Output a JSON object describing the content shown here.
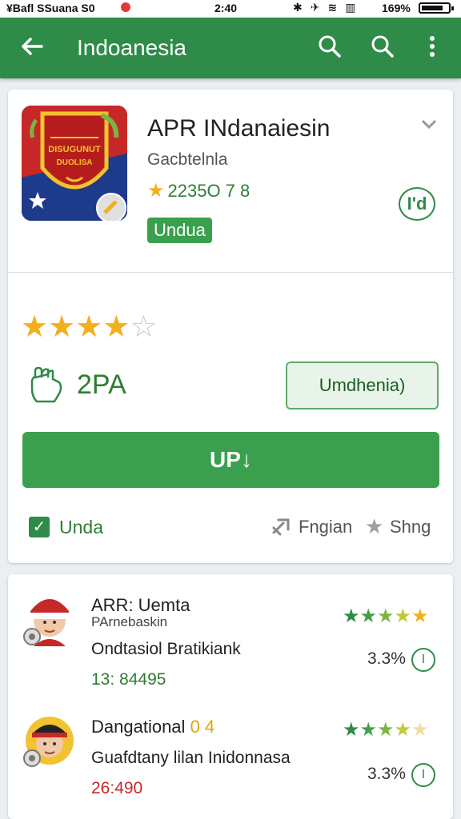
{
  "status_bar": {
    "carrier": "¥Bafl SSuana S0",
    "time": "2:40",
    "battery": "169%"
  },
  "app_bar": {
    "title": "Indoanesia"
  },
  "app": {
    "title": "APR INdanaiesin",
    "developer": "Gacbtelnla",
    "rating_text": "2235O 7 8",
    "badge": "Undua",
    "side_button": "I'd",
    "icon_text": "DISUGUNUT DUOLISA"
  },
  "rating": {
    "stars": 4,
    "max": 5
  },
  "stats": {
    "count": "2PA",
    "secondary_button": "Umdhenia)"
  },
  "primary_button": "UP↓",
  "actions": {
    "check_label": "Unda",
    "link_label": "Fngian",
    "share_label": "Shng"
  },
  "reviews": [
    {
      "name": "ARR: Uemta",
      "sub": "PArnebaskin",
      "text": "Ondtasiol Bratikiank",
      "date": "13: 84495",
      "percent": "3.3%",
      "stars": 5
    },
    {
      "name": "Dangational",
      "name_suffix": "0 4",
      "text": "Guafdtany lilan Inidonnasa",
      "date": "26:490",
      "percent": "3.3%",
      "stars": 4
    }
  ],
  "colors": {
    "primary": "#2e8b48",
    "accent_star": "#f2b01e",
    "button": "#3aa04d"
  }
}
